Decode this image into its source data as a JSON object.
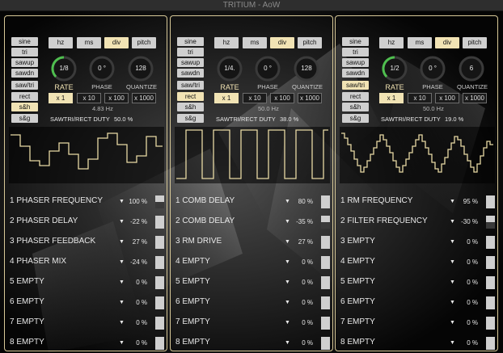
{
  "window": {
    "title": "TRITIUM - AoW"
  },
  "panels": [
    {
      "waveforms": [
        "sine",
        "tri",
        "sawup",
        "sawdn",
        "saw/tri",
        "rect",
        "s&h",
        "s&g"
      ],
      "waveform_selected": "s&h",
      "units": [
        "hz",
        "ms",
        "div",
        "pitch"
      ],
      "unit_selected": "div",
      "knobs": {
        "rate": "1/8",
        "phase": "0 °",
        "quantize": "128"
      },
      "knob_labels": {
        "rate": "RATE",
        "phase": "PHASE",
        "quantize": "QUANTIZE"
      },
      "multipliers": [
        "x 1",
        "x 10",
        "x 100",
        "x 1000"
      ],
      "multiplier_selected": "x 1",
      "hz_value": "4.83 Hz",
      "duty_label": "SAWTRI/RECT DUTY",
      "duty_value": "50.0 %",
      "rows": [
        {
          "label": "1 PHASER FREQUENCY",
          "value": "100 %"
        },
        {
          "label": "2 PHASER DELAY",
          "value": "-22 %"
        },
        {
          "label": "3 PHASER FEEDBACK",
          "value": "27 %"
        },
        {
          "label": "4 PHASER MIX",
          "value": "-24 %"
        },
        {
          "label": "5 EMPTY",
          "value": "0 %"
        },
        {
          "label": "6 EMPTY",
          "value": "0 %"
        },
        {
          "label": "7 EMPTY",
          "value": "0 %"
        },
        {
          "label": "8 EMPTY",
          "value": "0 %"
        }
      ]
    },
    {
      "waveforms": [
        "sine",
        "tri",
        "sawup",
        "sawdn",
        "saw/tri",
        "rect",
        "s&h",
        "s&g"
      ],
      "waveform_selected": "rect",
      "units": [
        "hz",
        "ms",
        "div",
        "pitch"
      ],
      "unit_selected": "div",
      "knobs": {
        "rate": "1/4.",
        "phase": "0 °",
        "quantize": "128"
      },
      "knob_labels": {
        "rate": "RATE",
        "phase": "PHASE",
        "quantize": "QUANTIZE"
      },
      "multipliers": [
        "x 1",
        "x 10",
        "x 100",
        "x 1000"
      ],
      "multiplier_selected": "x 1",
      "hz_value": "50.0 Hz",
      "duty_label": "SAWTRI/RECT DUTY",
      "duty_value": "38.0 %",
      "rows": [
        {
          "label": "1 COMB DELAY",
          "value": "80 %"
        },
        {
          "label": "2 COMB DELAY",
          "value": "-35 %"
        },
        {
          "label": "3 RM DRIVE",
          "value": "27 %"
        },
        {
          "label": "4 EMPTY",
          "value": "0 %"
        },
        {
          "label": "5 EMPTY",
          "value": "0 %"
        },
        {
          "label": "6 EMPTY",
          "value": "0 %"
        },
        {
          "label": "7 EMPTY",
          "value": "0 %"
        },
        {
          "label": "8 EMPTY",
          "value": "0 %"
        }
      ]
    },
    {
      "waveforms": [
        "sine",
        "tri",
        "sawup",
        "sawdn",
        "saw/tri",
        "rect",
        "s&h",
        "s&g"
      ],
      "waveform_selected": "saw/tri",
      "units": [
        "hz",
        "ms",
        "div",
        "pitch"
      ],
      "unit_selected": "div",
      "knobs": {
        "rate": "1/2",
        "phase": "0 °",
        "quantize": "6"
      },
      "knob_labels": {
        "rate": "RATE",
        "phase": "PHASE",
        "quantize": "QUANTIZE"
      },
      "multipliers": [
        "x 1",
        "x 10",
        "x 100",
        "x 1000"
      ],
      "multiplier_selected": "x 1",
      "hz_value": "50.0 Hz",
      "duty_label": "SAWTRI/RECT DUTY",
      "duty_value": "19.0 %",
      "rows": [
        {
          "label": "1 RM FREQUENCY",
          "value": "95 %"
        },
        {
          "label": "2 FILTER FREQUENCY",
          "value": "-30 %"
        },
        {
          "label": "3 EMPTY",
          "value": "0 %"
        },
        {
          "label": "4 EMPTY",
          "value": "0 %"
        },
        {
          "label": "5 EMPTY",
          "value": "0 %"
        },
        {
          "label": "6 EMPTY",
          "value": "0 %"
        },
        {
          "label": "7 EMPTY",
          "value": "0 %"
        },
        {
          "label": "8 EMPTY",
          "value": "0 %"
        }
      ]
    }
  ]
}
